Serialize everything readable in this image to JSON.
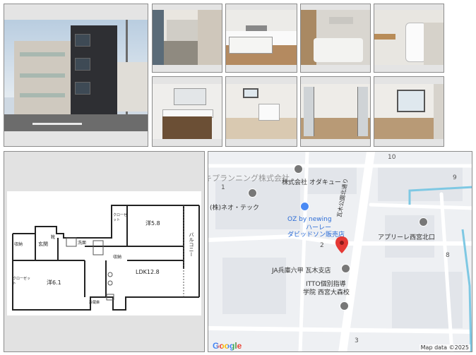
{
  "map": {
    "labels": [
      {
        "id": "odakyu",
        "text": "株式会社 オダキュー",
        "kind": "poi"
      },
      {
        "id": "neotech",
        "text": "(株)ネオ・テック",
        "kind": "poi"
      },
      {
        "id": "oz",
        "text": "OZ by newing",
        "kind": "shop"
      },
      {
        "id": "harley",
        "text": "ハーレー",
        "kind": "shop"
      },
      {
        "id": "davidson",
        "text": "ダビッドソン販売店",
        "kind": "shop"
      },
      {
        "id": "apurire",
        "text": "アプリーレ西宮北口",
        "kind": "poi"
      },
      {
        "id": "ja",
        "text": "JA兵庫六甲 瓦木支店",
        "kind": "poi"
      },
      {
        "id": "itto1",
        "text": "ITTO個別指導",
        "kind": "poi"
      },
      {
        "id": "itto2",
        "text": "学院 西宮大森校",
        "kind": "poi"
      },
      {
        "id": "road",
        "text": "瓦木公園北通り",
        "kind": "road"
      }
    ],
    "numbers": [
      "1",
      "10",
      "9",
      "2",
      "8",
      "3"
    ],
    "watermark": "ユウキプランニング株式会社",
    "logo": "Google",
    "attribution": "Map data ©2025"
  },
  "floorplan": {
    "rooms": [
      {
        "id": "yoshitsu_top",
        "text": "洋5.8"
      },
      {
        "id": "yoshitsu_bottom",
        "text": "洋6.1"
      },
      {
        "id": "ldk",
        "text": "LDK12.8"
      },
      {
        "id": "balcony",
        "text": "バルコニー"
      },
      {
        "id": "closet1",
        "text": "クローゼット"
      },
      {
        "id": "closet2",
        "text": "クローゼット"
      },
      {
        "id": "genkan",
        "text": "玄関"
      },
      {
        "id": "shoes",
        "text": "靴"
      },
      {
        "id": "washroom",
        "text": "洗面"
      },
      {
        "id": "storage1",
        "text": "収納"
      },
      {
        "id": "storage2",
        "text": "収納"
      },
      {
        "id": "fridge",
        "text": "冷蔵庫"
      }
    ]
  },
  "colors": {
    "pin": "#e53935",
    "road": "#ffffff",
    "water": "#7ec8e3",
    "border": "#8c8c8c"
  }
}
